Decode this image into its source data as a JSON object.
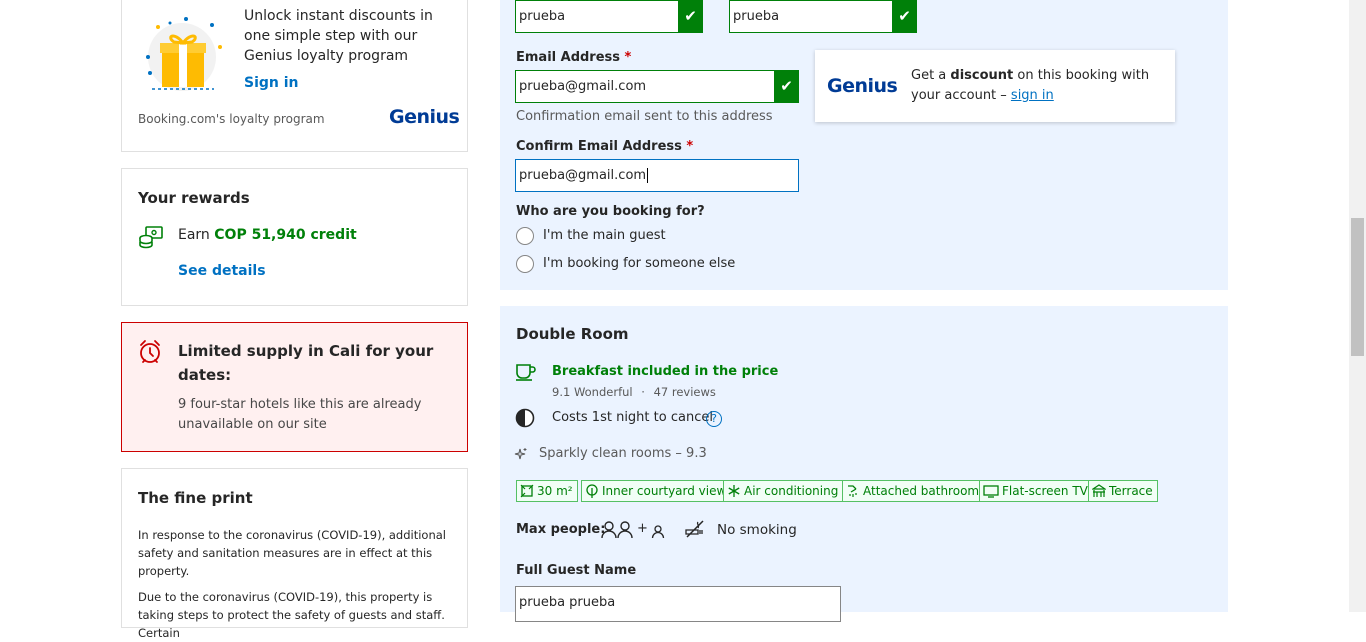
{
  "genius_card": {
    "promo_text": "Unlock instant discounts in one simple step with our Genius loyalty program",
    "sign_in": "Sign in",
    "footer": "Booking.com's loyalty program",
    "brand": "Genius"
  },
  "rewards": {
    "title": "Your rewards",
    "earn_prefix": "Earn",
    "earn_amount": "COP 51,940 credit",
    "see_details": "See details"
  },
  "limited_supply": {
    "title": "Limited supply in Cali for your dates:",
    "body": "9 four-star hotels like this are already unavailable on our site"
  },
  "fine_print": {
    "title": "The fine print",
    "para1": "In response to the coronavirus (COVID-19), additional safety and sanitation measures are in effect at this property.",
    "para2": "Due to the coronavirus (COVID-19), this property is taking steps to protect the safety of guests and staff. Certain"
  },
  "form": {
    "first_name_value": "prueba",
    "last_name_value": "prueba",
    "email_label": "Email Address",
    "email_value": "prueba@gmail.com",
    "email_hint": "Confirmation email sent to this address",
    "confirm_email_label": "Confirm Email Address",
    "confirm_email_value": "prueba@gmail.com",
    "required_mark": "*",
    "booking_for_label": "Who are you booking for?",
    "option_main": "I'm the main guest",
    "option_other": "I'm booking for someone else"
  },
  "genius_popup": {
    "brand": "Genius",
    "text_pre": "Get a ",
    "text_bold": "discount",
    "text_post": " on this booking with your account – ",
    "sign_in": "sign in"
  },
  "room": {
    "title": "Double Room",
    "breakfast": "Breakfast included in the price",
    "score": "9.1 Wonderful",
    "separator": "·",
    "reviews": "47 reviews",
    "cancel": "Costs 1st night to cancel",
    "help": "?",
    "clean": "Sparkly clean rooms – 9.3",
    "facilities": [
      "30 m²",
      "Inner courtyard view",
      "Air conditioning",
      "Attached bathroom",
      "Flat-screen TV",
      "Terrace"
    ],
    "max_people_label": "Max people:",
    "plus": "+",
    "no_smoking": "No smoking",
    "full_guest_name_label": "Full Guest Name",
    "full_guest_name_value": "prueba prueba"
  },
  "colors": {
    "brand_blue": "#003b95",
    "link_blue": "#0071c2",
    "success_green": "#008009",
    "alert_red": "#cc0000",
    "panel_blue": "#ebf3ff"
  }
}
